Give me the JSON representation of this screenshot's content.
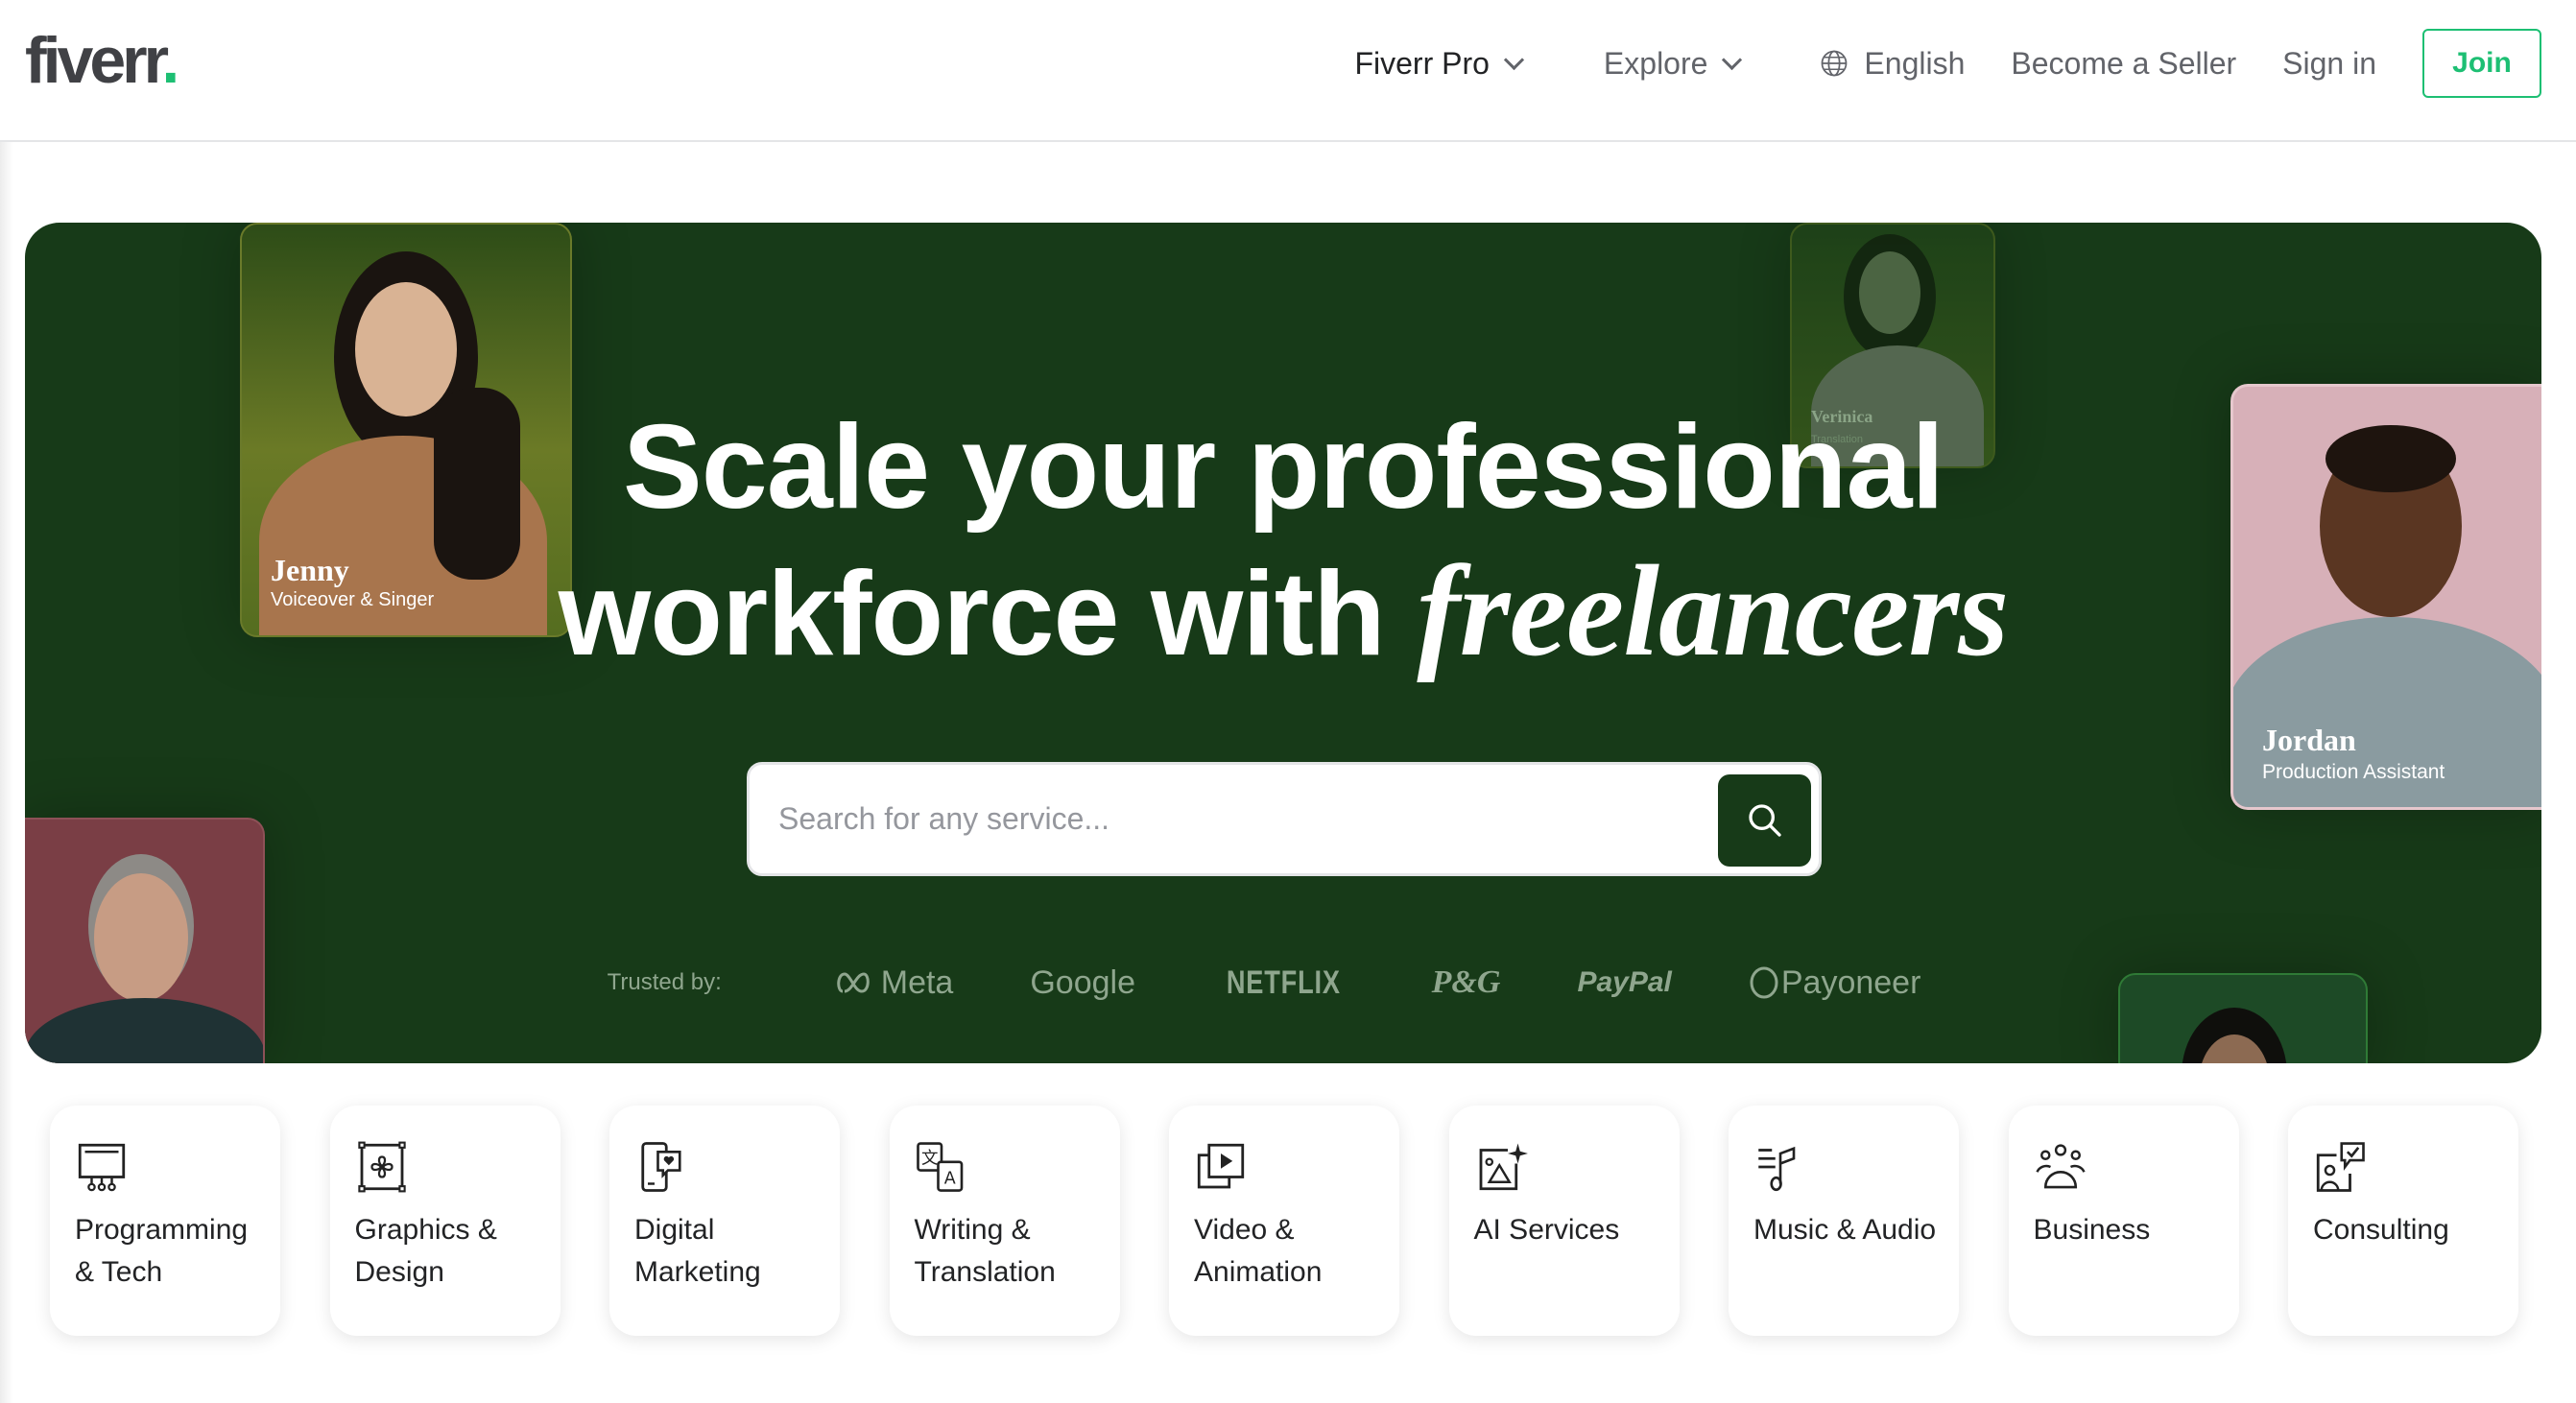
{
  "header": {
    "logo": "fiverr",
    "logo_dot": ".",
    "nav": {
      "fiverr_pro": "Fiverr Pro",
      "explore": "Explore",
      "language": "English",
      "become_seller": "Become a Seller",
      "sign_in": "Sign in",
      "join": "Join"
    }
  },
  "hero": {
    "headline_line1": "Scale your professional",
    "headline_line2_plain": "workforce with ",
    "headline_line2_italic": "freelancers",
    "search": {
      "placeholder": "Search for any service...",
      "value": ""
    },
    "trusted_label": "Trusted by:",
    "brands": [
      "Meta",
      "Google",
      "NETFLIX",
      "P&G",
      "PayPal",
      "Payoneer"
    ],
    "freelancers": [
      {
        "name": "Jenny",
        "role": "Voiceover & Singer"
      },
      {
        "name": "Verinica",
        "role": "Translation"
      },
      {
        "name": "Jordan",
        "role": "Production Assistant"
      }
    ]
  },
  "categories": [
    {
      "label": "Programming & Tech",
      "icon": "monitor-circuit-icon"
    },
    {
      "label": "Graphics & Design",
      "icon": "design-frame-icon"
    },
    {
      "label": "Digital Marketing",
      "icon": "phone-heart-icon"
    },
    {
      "label": "Writing & Translation",
      "icon": "translate-icon"
    },
    {
      "label": "Video & Animation",
      "icon": "video-play-icon"
    },
    {
      "label": "AI Services",
      "icon": "ai-image-icon"
    },
    {
      "label": "Music & Audio",
      "icon": "music-note-icon"
    },
    {
      "label": "Business",
      "icon": "people-group-icon"
    },
    {
      "label": "Consulting",
      "icon": "consulting-icon"
    }
  ],
  "colors": {
    "brand_green": "#1dbf73",
    "hero_bg": "#173a18",
    "text_dark": "#222325",
    "text_muted": "#62646a"
  }
}
